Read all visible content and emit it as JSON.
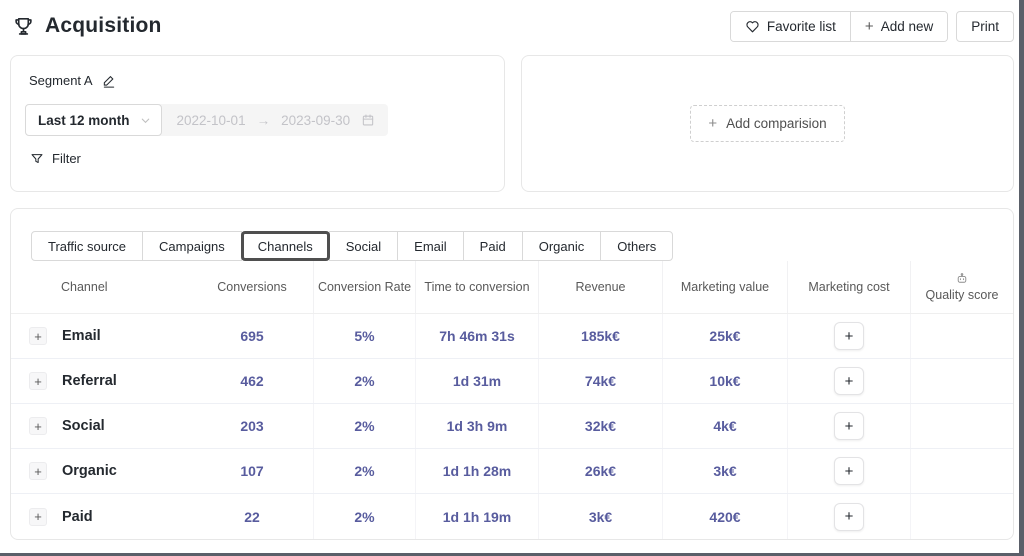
{
  "header": {
    "title": "Acquisition",
    "favorite_button": "Favorite list",
    "add_new_button": "Add new",
    "add_new_plus": "+",
    "print_button": "Print"
  },
  "segment_panel": {
    "segment_name": "Segment A",
    "period_select": "Last 12 month",
    "date_start": "2022-10-01",
    "date_arrow": "→",
    "date_end": "2023-09-30",
    "filter_label": "Filter"
  },
  "comparison_panel": {
    "plus": "+",
    "add_comparison_label": "Add comparision"
  },
  "tabs": [
    {
      "label": "Traffic source",
      "selected": false
    },
    {
      "label": "Campaigns",
      "selected": false
    },
    {
      "label": "Channels",
      "selected": true
    },
    {
      "label": "Social",
      "selected": false
    },
    {
      "label": "Email",
      "selected": false
    },
    {
      "label": "Paid",
      "selected": false
    },
    {
      "label": "Organic",
      "selected": false
    },
    {
      "label": "Others",
      "selected": false
    }
  ],
  "table": {
    "columns": [
      "Channel",
      "Conversions",
      "Conversion Rate",
      "Time to conversion",
      "Revenue",
      "Marketing value",
      "Marketing cost",
      "Quality score"
    ],
    "expander_symbol": "+",
    "rows": [
      {
        "channel": "Email",
        "conversions": "695",
        "conversion_rate": "5%",
        "time_to_conversion": "7h 46m 31s",
        "revenue": "185k€",
        "marketing_value": "25k€",
        "marketing_cost_button": "+"
      },
      {
        "channel": "Referral",
        "conversions": "462",
        "conversion_rate": "2%",
        "time_to_conversion": "1d 31m",
        "revenue": "74k€",
        "marketing_value": "10k€",
        "marketing_cost_button": "+"
      },
      {
        "channel": "Social",
        "conversions": "203",
        "conversion_rate": "2%",
        "time_to_conversion": "1d 3h 9m",
        "revenue": "32k€",
        "marketing_value": "4k€",
        "marketing_cost_button": "+"
      },
      {
        "channel": "Organic",
        "conversions": "107",
        "conversion_rate": "2%",
        "time_to_conversion": "1d 1h 28m",
        "revenue": "26k€",
        "marketing_value": "3k€",
        "marketing_cost_button": "+"
      },
      {
        "channel": "Paid",
        "conversions": "22",
        "conversion_rate": "2%",
        "time_to_conversion": "1d 1h 19m",
        "revenue": "3k€",
        "marketing_value": "420€",
        "marketing_cost_button": "+"
      }
    ]
  },
  "colors": {
    "value_text": "#585c9e",
    "selected_tab_border": "#4f4f4f",
    "window_edge": "#5a5f69"
  }
}
